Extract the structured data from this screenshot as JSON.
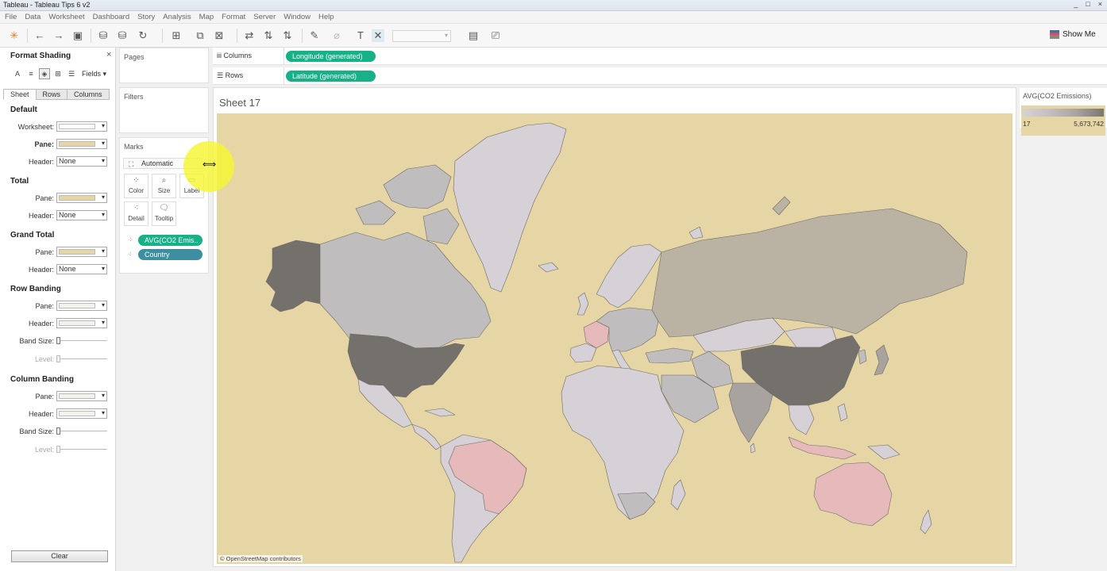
{
  "window": {
    "title": "Tableau - Tableau Tips 6 v2",
    "controls": [
      "_",
      "□",
      "×"
    ]
  },
  "menu": [
    "File",
    "Data",
    "Worksheet",
    "Dashboard",
    "Story",
    "Analysis",
    "Map",
    "Format",
    "Server",
    "Window",
    "Help"
  ],
  "toolbar": {
    "show_me": "Show Me"
  },
  "format_pane": {
    "title": "Format Shading",
    "close": "×",
    "fields_label": "Fields",
    "tabs": [
      "Sheet",
      "Rows",
      "Columns"
    ],
    "default_title": "Default",
    "total_title": "Total",
    "grand_total_title": "Grand Total",
    "row_banding_title": "Row Banding",
    "column_banding_title": "Column Banding",
    "labels": {
      "worksheet": "Worksheet:",
      "pane": "Pane:",
      "header": "Header:",
      "band_size": "Band Size:",
      "level": "Level:"
    },
    "none": "None",
    "clear": "Clear",
    "colors": {
      "pane": "#e6d6a5",
      "white": "#ffffff",
      "band": "#f2f2ec"
    }
  },
  "cards": {
    "pages": "Pages",
    "filters": "Filters",
    "marks": "Marks",
    "mark_type": "Automatic",
    "buttons": [
      "Color",
      "Size",
      "Label",
      "Detail",
      "Tooltip"
    ],
    "pill_color": "AVG(CO2 Emis..",
    "pill_detail": "Country"
  },
  "shelves": {
    "columns_label": "Columns",
    "rows_label": "Rows",
    "columns_pill": "Longitude (generated)",
    "rows_pill": "Latitude (generated)"
  },
  "sheet": {
    "title": "Sheet 17",
    "attribution": "© OpenStreetMap contributors"
  },
  "legend": {
    "title": "AVG(CO2 Emissions)",
    "min": "17",
    "max": "5,673,742"
  }
}
